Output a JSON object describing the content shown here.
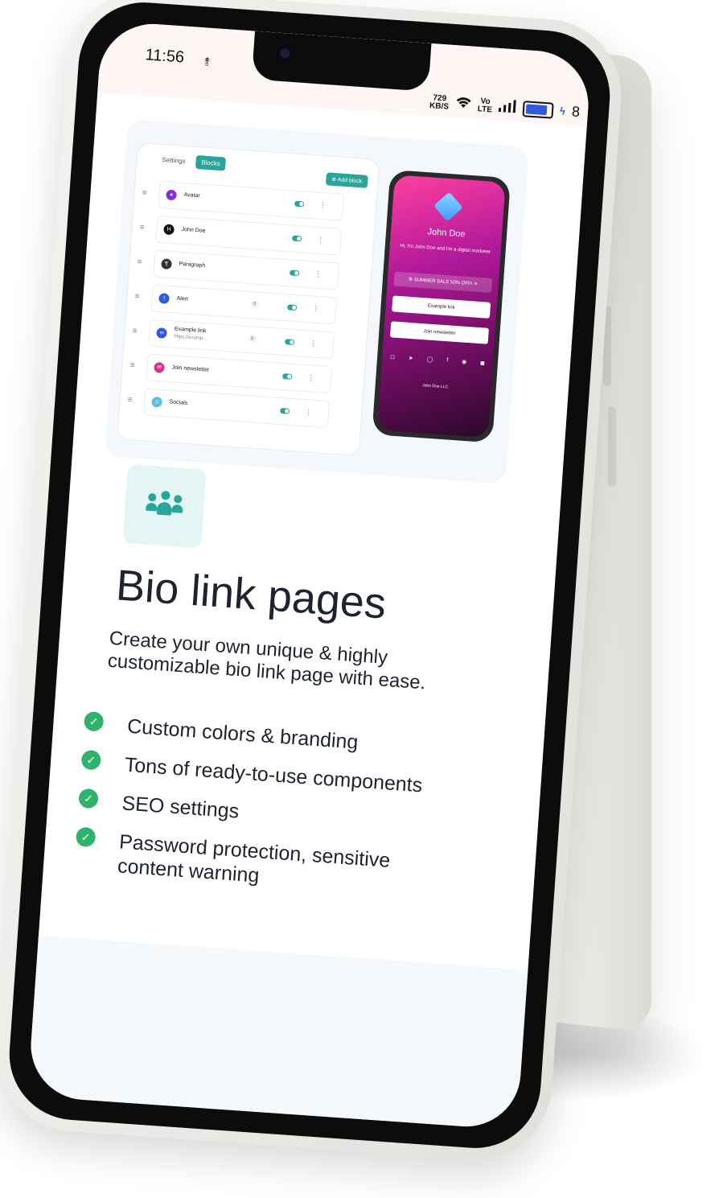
{
  "status_bar": {
    "time": "11:56",
    "data_speed_value": "729",
    "data_speed_unit": "KB/S",
    "network_label_top": "Vo",
    "network_label_bottom": "LTE",
    "battery_partial": "8"
  },
  "preview": {
    "tabs": [
      "Settings",
      "Blocks"
    ],
    "add_block_label": "Add block",
    "blocks": [
      {
        "label": "Avatar",
        "sub": "",
        "badge": "",
        "icon": "avatar-icon",
        "color": "#8a2be2"
      },
      {
        "label": "John Doe",
        "sub": "",
        "badge": "",
        "icon": "heading-icon",
        "color": "#111111"
      },
      {
        "label": "Paragraph",
        "sub": "",
        "badge": "",
        "icon": "paragraph-icon",
        "color": "#333333"
      },
      {
        "label": "Alert",
        "sub": "",
        "badge": "0",
        "icon": "alert-icon",
        "color": "#2f5be0"
      },
      {
        "label": "Example link",
        "sub": "https://examp...",
        "badge": "0",
        "icon": "link-icon",
        "color": "#2f5be0"
      },
      {
        "label": "Join newsletter",
        "sub": "",
        "badge": "",
        "icon": "newsletter-icon",
        "color": "#d63384"
      },
      {
        "label": "Socials",
        "sub": "",
        "badge": "",
        "icon": "socials-icon",
        "color": "#5bc0de"
      }
    ],
    "mini_phone": {
      "name": "John Doe",
      "bio": "Hi, I'm John Doe and I'm a digital marketer",
      "alert": "SUMMER SALE 50% OFF!",
      "link_button": "Example link",
      "newsletter_button": "Join newsletter",
      "footer": "John Doe LLC."
    }
  },
  "feature": {
    "icon": "users-icon",
    "title": "Bio link pages",
    "subtitle": "Create your own unique & highly customizable bio link page with ease.",
    "items": [
      "Custom colors & branding",
      "Tons of ready-to-use components",
      "SEO settings",
      "Password protection, sensitive content warning"
    ]
  },
  "colors": {
    "accent": "#2aa59a",
    "check": "#2db36a",
    "text": "#1e2330"
  }
}
